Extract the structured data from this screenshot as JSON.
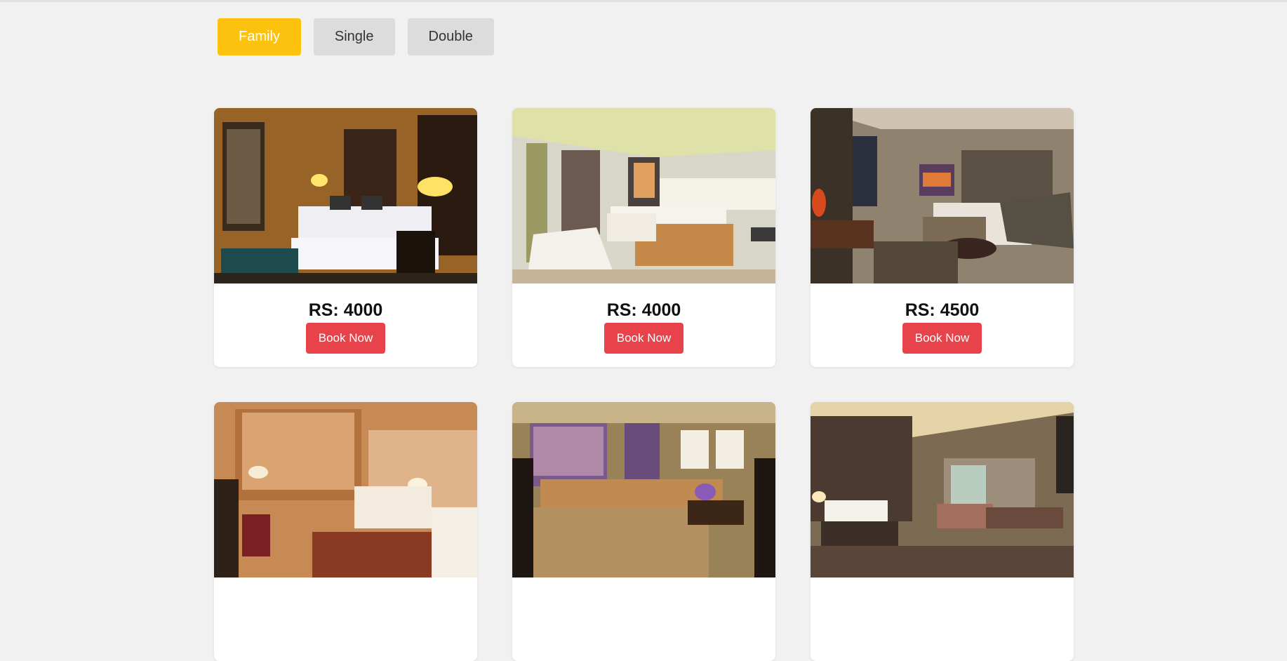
{
  "filters": [
    {
      "label": "Family",
      "active": true
    },
    {
      "label": "Single",
      "active": false
    },
    {
      "label": "Double",
      "active": false
    }
  ],
  "rooms": [
    {
      "price": "RS: 4000",
      "button": "Book Now"
    },
    {
      "price": "RS: 4000",
      "button": "Book Now"
    },
    {
      "price": "RS: 4500",
      "button": "Book Now"
    },
    {
      "price": "",
      "button": ""
    },
    {
      "price": "",
      "button": ""
    },
    {
      "price": "",
      "button": ""
    }
  ],
  "colors": {
    "active_filter": "#fdc20e",
    "inactive_filter": "#dcdcdc",
    "book_button": "#e8434a",
    "background": "#f1f1f1"
  }
}
